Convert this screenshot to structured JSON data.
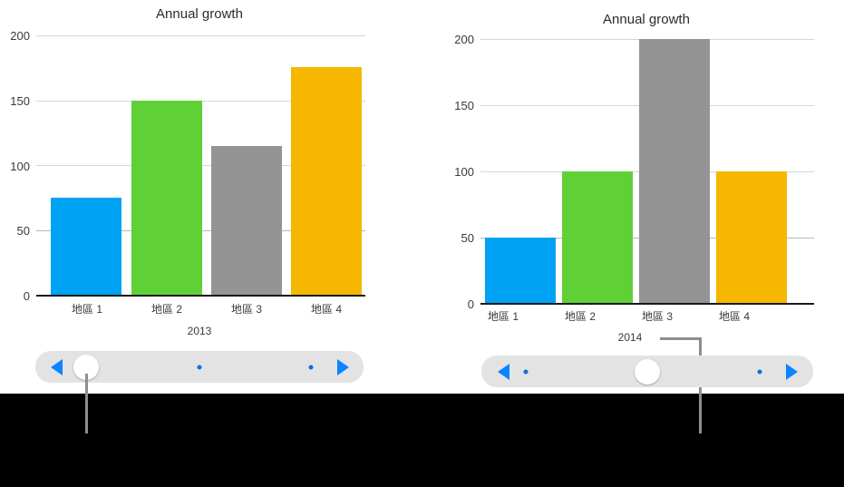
{
  "background": {
    "page_color": "#ffffff",
    "lower_band_color": "#000000"
  },
  "palette": {
    "series_1": "#00a2f3",
    "series_2": "#5fd137",
    "series_3": "#949494",
    "series_4": "#f5b700",
    "grid": "#d6d6d6",
    "axis": "#1a1a1a",
    "accent_blue": "#0a84ff",
    "callout_gray": "#8e8e8e",
    "slider_track": "#e3e3e3"
  },
  "left_panel": {
    "name": "chart-panel-2013",
    "series_label": "2013",
    "slider": {
      "prev_label": "◀",
      "next_label": "▶",
      "knob_position_percent": 14,
      "dots": [
        50,
        83
      ]
    }
  },
  "right_panel": {
    "name": "chart-panel-2014",
    "series_label": "2014",
    "slider": {
      "prev_label": "◀",
      "next_label": "▶",
      "knob_position_percent": 50,
      "dots": [
        13,
        83
      ]
    }
  },
  "chart_data": [
    {
      "id": "left",
      "type": "bar",
      "title": "Annual growth",
      "xlabel": "2013",
      "ylabel": "",
      "categories": [
        "地區 1",
        "地區 2",
        "地區 3",
        "地區 4"
      ],
      "values": [
        75,
        150,
        115,
        176
      ],
      "colors": [
        "#00a2f3",
        "#5fd137",
        "#949494",
        "#f5b700"
      ],
      "ylim": [
        0,
        200
      ],
      "yticks": [
        0,
        50,
        100,
        150,
        200
      ],
      "ytick_labels": [
        "0",
        "50",
        "100",
        "150",
        "200"
      ],
      "grid": true,
      "legend": false
    },
    {
      "id": "right",
      "type": "bar",
      "title": "Annual growth",
      "xlabel": "2014",
      "ylabel": "",
      "categories": [
        "地區 1",
        "地區 2",
        "地區 3",
        "地區 4"
      ],
      "values": [
        50,
        100,
        200,
        100
      ],
      "colors": [
        "#00a2f3",
        "#5fd137",
        "#949494",
        "#f5b700"
      ],
      "ylim": [
        0,
        200
      ],
      "yticks": [
        0,
        50,
        100,
        150,
        200
      ],
      "ytick_labels": [
        "0",
        "50",
        "100",
        "150",
        "200"
      ],
      "grid": true,
      "legend": false
    }
  ]
}
